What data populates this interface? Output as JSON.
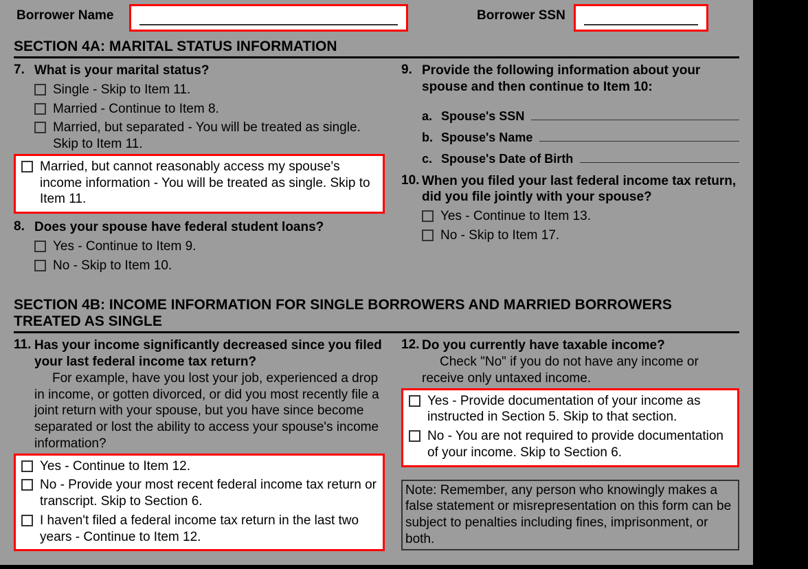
{
  "header": {
    "name_label": "Borrower Name",
    "ssn_label": "Borrower SSN"
  },
  "section4a": {
    "title": "SECTION 4A: MARITAL STATUS INFORMATION",
    "q7": {
      "num": "7.",
      "text": "What is your marital status?",
      "opts": {
        "a": "Single - Skip to Item 11.",
        "b": "Married - Continue to Item 8.",
        "c": "Married, but separated - You will be treated as single. Skip  to Item 11.",
        "d": "Married, but cannot reasonably access my spouse's income information - You will be treated as single. Skip to Item 11."
      }
    },
    "q8": {
      "num": "8.",
      "text": "Does your spouse have federal student loans?",
      "opts": {
        "a": "Yes - Continue to Item 9.",
        "b": "No - Skip to Item 10."
      }
    },
    "q9": {
      "num": "9.",
      "text": "Provide the following information about your spouse and then continue to Item 10:",
      "subs": {
        "a_letter": "a.",
        "a_label": "Spouse's SSN",
        "b_letter": "b.",
        "b_label": "Spouse's Name",
        "c_letter": "c.",
        "c_label": "Spouse's Date of Birth"
      }
    },
    "q10": {
      "num": "10.",
      "text": "When you filed your last federal income tax return, did you file jointly with your spouse?",
      "opts": {
        "a": "Yes - Continue to Item 13.",
        "b": "No - Skip to Item 17."
      }
    }
  },
  "section4b": {
    "title": "SECTION 4B: INCOME INFORMATION FOR SINGLE BORROWERS AND MARRIED BORROWERS TREATED AS SINGLE",
    "q11": {
      "num": "11.",
      "text": "Has your income significantly decreased since you filed your last federal income tax return?",
      "para": "For example, have you lost your job, experienced a drop in income, or gotten divorced, or did you most recently file a joint return with your spouse, but you have since become separated or lost the ability to access your spouse's income information?",
      "opts": {
        "a": "Yes - Continue to Item 12.",
        "b": "No - Provide your most recent federal income tax return or transcript. Skip to Section 6.",
        "c": "I haven't filed a federal income tax return in the last two years - Continue to Item 12."
      }
    },
    "q12": {
      "num": "12.",
      "text": "Do you currently have taxable income?",
      "para": "Check \"No\" if you do not have any income or receive only untaxed income.",
      "opts": {
        "a": "Yes - Provide documentation of your income as instructed in Section 5. Skip to that section.",
        "b": "No - You are not required to provide documentation of your income. Skip to Section 6."
      }
    },
    "note": "Note: Remember, any person who knowingly makes a false statement or misrepresentation on this form can be subject to penalties including fines, imprisonment, or both."
  }
}
